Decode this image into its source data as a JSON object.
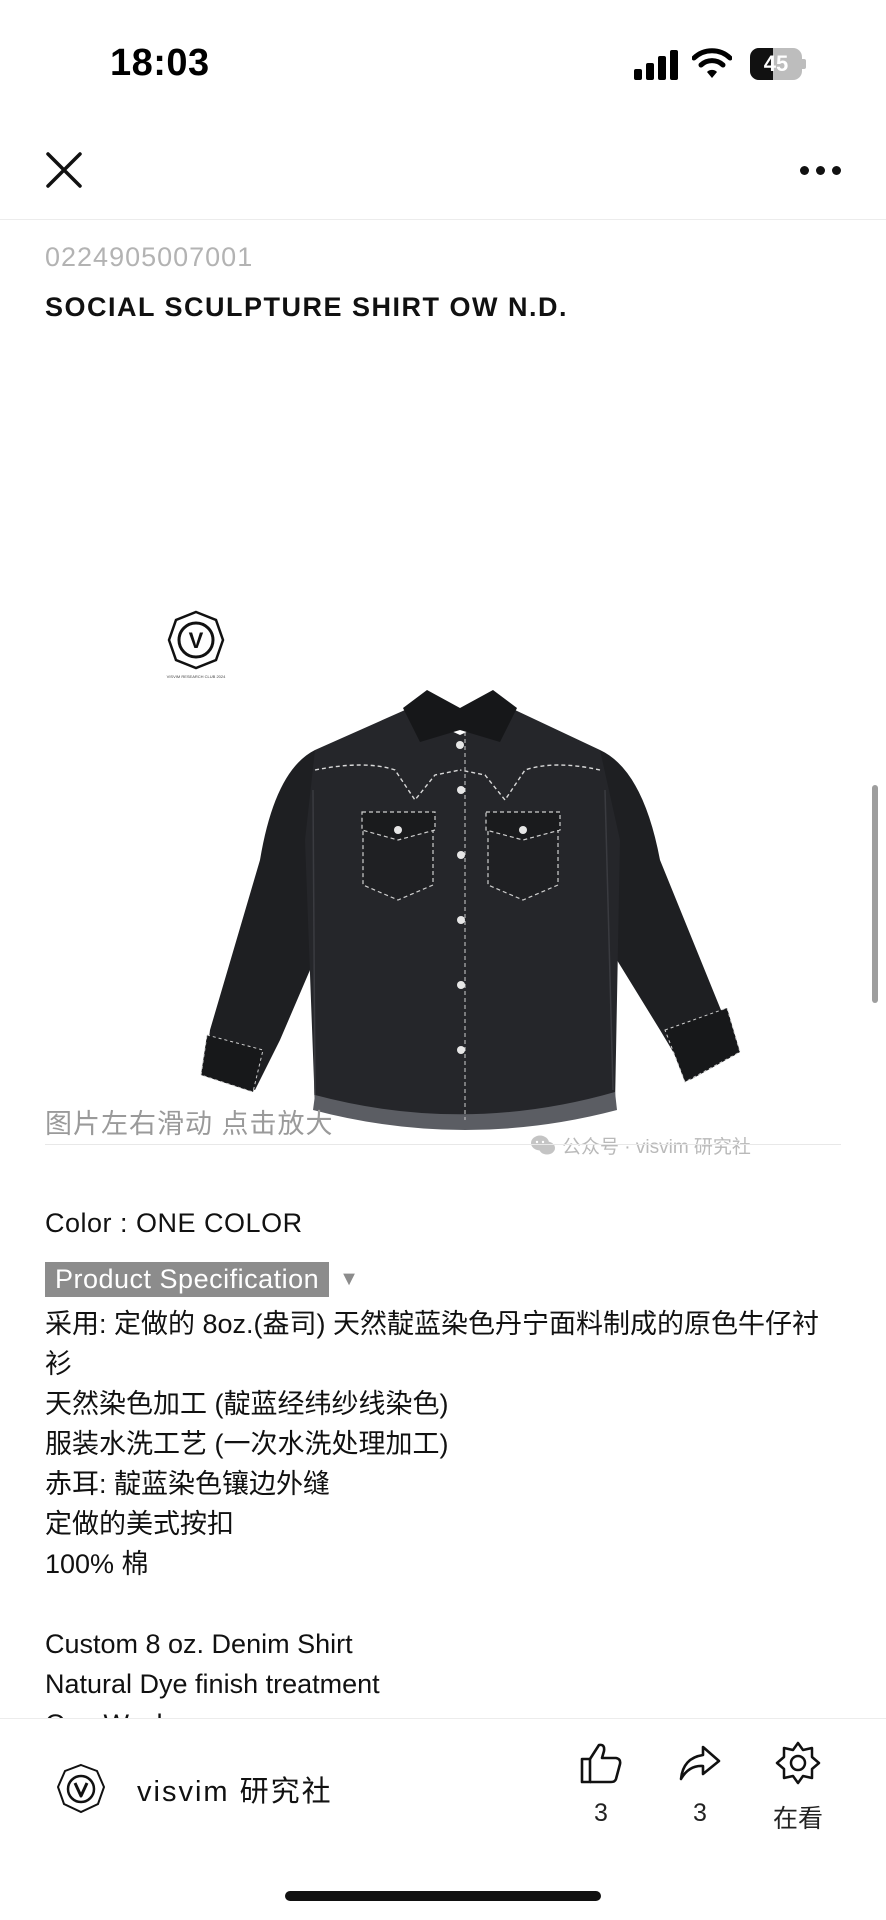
{
  "status_bar": {
    "time": "18:03",
    "battery_level": "45",
    "battery_fraction": 0.45,
    "icons": [
      "signal-icon",
      "wifi-icon",
      "battery-icon"
    ]
  },
  "nav": {
    "close_icon": "close-icon",
    "more_icon": "more-icon"
  },
  "article": {
    "product_code": "0224905007001",
    "product_title": "SOCIAL SCULPTURE SHIRT OW N.D.",
    "gallery": {
      "brand_letter": "V",
      "brand_tagline": "VISVIM RESEARCH CLUB 2024",
      "watermark_text": "公众号 · visvim 研究社",
      "hint": "图片左右滑动 点击放大"
    },
    "color_label": "Color",
    "color_separator": " : ",
    "color_value": "ONE COLOR",
    "spec_heading": "Product Specification",
    "spec_caret": "▼",
    "description_cn": [
      "采用: 定做的 8oz.(盎司) 天然靛蓝染色丹宁面料制成的原色牛仔衬衫",
      "天然染色加工 (靛蓝经纬纱线染色)",
      "服装水洗工艺 (一次水洗处理加工)",
      "赤耳: 靛蓝染色镶边外缝",
      "定做的美式按扣",
      "100% 棉"
    ],
    "description_en": [
      "Custom 8 oz. Denim Shirt",
      "Natural Dye finish treatment",
      "One Wash"
    ]
  },
  "bottom_bar": {
    "account_name": "visvim 研究社",
    "like_count": "3",
    "share_count": "3",
    "watching_label": "在看"
  },
  "colors": {
    "text": "#111111",
    "muted": "#9a9a9a",
    "code": "#b3b3b3",
    "spec_badge": "#8c8c8c",
    "shirt": "#1e1f22"
  }
}
